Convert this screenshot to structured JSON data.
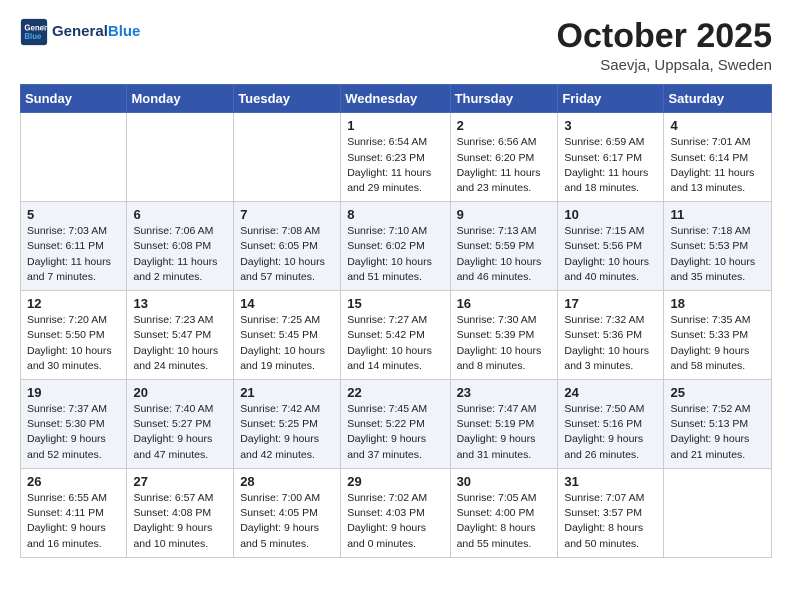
{
  "logo": {
    "line1": "General",
    "line2": "Blue"
  },
  "title": "October 2025",
  "subtitle": "Saevja, Uppsala, Sweden",
  "header_days": [
    "Sunday",
    "Monday",
    "Tuesday",
    "Wednesday",
    "Thursday",
    "Friday",
    "Saturday"
  ],
  "weeks": [
    [
      {
        "day": "",
        "info": ""
      },
      {
        "day": "",
        "info": ""
      },
      {
        "day": "",
        "info": ""
      },
      {
        "day": "1",
        "info": "Sunrise: 6:54 AM\nSunset: 6:23 PM\nDaylight: 11 hours\nand 29 minutes."
      },
      {
        "day": "2",
        "info": "Sunrise: 6:56 AM\nSunset: 6:20 PM\nDaylight: 11 hours\nand 23 minutes."
      },
      {
        "day": "3",
        "info": "Sunrise: 6:59 AM\nSunset: 6:17 PM\nDaylight: 11 hours\nand 18 minutes."
      },
      {
        "day": "4",
        "info": "Sunrise: 7:01 AM\nSunset: 6:14 PM\nDaylight: 11 hours\nand 13 minutes."
      }
    ],
    [
      {
        "day": "5",
        "info": "Sunrise: 7:03 AM\nSunset: 6:11 PM\nDaylight: 11 hours\nand 7 minutes."
      },
      {
        "day": "6",
        "info": "Sunrise: 7:06 AM\nSunset: 6:08 PM\nDaylight: 11 hours\nand 2 minutes."
      },
      {
        "day": "7",
        "info": "Sunrise: 7:08 AM\nSunset: 6:05 PM\nDaylight: 10 hours\nand 57 minutes."
      },
      {
        "day": "8",
        "info": "Sunrise: 7:10 AM\nSunset: 6:02 PM\nDaylight: 10 hours\nand 51 minutes."
      },
      {
        "day": "9",
        "info": "Sunrise: 7:13 AM\nSunset: 5:59 PM\nDaylight: 10 hours\nand 46 minutes."
      },
      {
        "day": "10",
        "info": "Sunrise: 7:15 AM\nSunset: 5:56 PM\nDaylight: 10 hours\nand 40 minutes."
      },
      {
        "day": "11",
        "info": "Sunrise: 7:18 AM\nSunset: 5:53 PM\nDaylight: 10 hours\nand 35 minutes."
      }
    ],
    [
      {
        "day": "12",
        "info": "Sunrise: 7:20 AM\nSunset: 5:50 PM\nDaylight: 10 hours\nand 30 minutes."
      },
      {
        "day": "13",
        "info": "Sunrise: 7:23 AM\nSunset: 5:47 PM\nDaylight: 10 hours\nand 24 minutes."
      },
      {
        "day": "14",
        "info": "Sunrise: 7:25 AM\nSunset: 5:45 PM\nDaylight: 10 hours\nand 19 minutes."
      },
      {
        "day": "15",
        "info": "Sunrise: 7:27 AM\nSunset: 5:42 PM\nDaylight: 10 hours\nand 14 minutes."
      },
      {
        "day": "16",
        "info": "Sunrise: 7:30 AM\nSunset: 5:39 PM\nDaylight: 10 hours\nand 8 minutes."
      },
      {
        "day": "17",
        "info": "Sunrise: 7:32 AM\nSunset: 5:36 PM\nDaylight: 10 hours\nand 3 minutes."
      },
      {
        "day": "18",
        "info": "Sunrise: 7:35 AM\nSunset: 5:33 PM\nDaylight: 9 hours\nand 58 minutes."
      }
    ],
    [
      {
        "day": "19",
        "info": "Sunrise: 7:37 AM\nSunset: 5:30 PM\nDaylight: 9 hours\nand 52 minutes."
      },
      {
        "day": "20",
        "info": "Sunrise: 7:40 AM\nSunset: 5:27 PM\nDaylight: 9 hours\nand 47 minutes."
      },
      {
        "day": "21",
        "info": "Sunrise: 7:42 AM\nSunset: 5:25 PM\nDaylight: 9 hours\nand 42 minutes."
      },
      {
        "day": "22",
        "info": "Sunrise: 7:45 AM\nSunset: 5:22 PM\nDaylight: 9 hours\nand 37 minutes."
      },
      {
        "day": "23",
        "info": "Sunrise: 7:47 AM\nSunset: 5:19 PM\nDaylight: 9 hours\nand 31 minutes."
      },
      {
        "day": "24",
        "info": "Sunrise: 7:50 AM\nSunset: 5:16 PM\nDaylight: 9 hours\nand 26 minutes."
      },
      {
        "day": "25",
        "info": "Sunrise: 7:52 AM\nSunset: 5:13 PM\nDaylight: 9 hours\nand 21 minutes."
      }
    ],
    [
      {
        "day": "26",
        "info": "Sunrise: 6:55 AM\nSunset: 4:11 PM\nDaylight: 9 hours\nand 16 minutes."
      },
      {
        "day": "27",
        "info": "Sunrise: 6:57 AM\nSunset: 4:08 PM\nDaylight: 9 hours\nand 10 minutes."
      },
      {
        "day": "28",
        "info": "Sunrise: 7:00 AM\nSunset: 4:05 PM\nDaylight: 9 hours\nand 5 minutes."
      },
      {
        "day": "29",
        "info": "Sunrise: 7:02 AM\nSunset: 4:03 PM\nDaylight: 9 hours\nand 0 minutes."
      },
      {
        "day": "30",
        "info": "Sunrise: 7:05 AM\nSunset: 4:00 PM\nDaylight: 8 hours\nand 55 minutes."
      },
      {
        "day": "31",
        "info": "Sunrise: 7:07 AM\nSunset: 3:57 PM\nDaylight: 8 hours\nand 50 minutes."
      },
      {
        "day": "",
        "info": ""
      }
    ]
  ]
}
